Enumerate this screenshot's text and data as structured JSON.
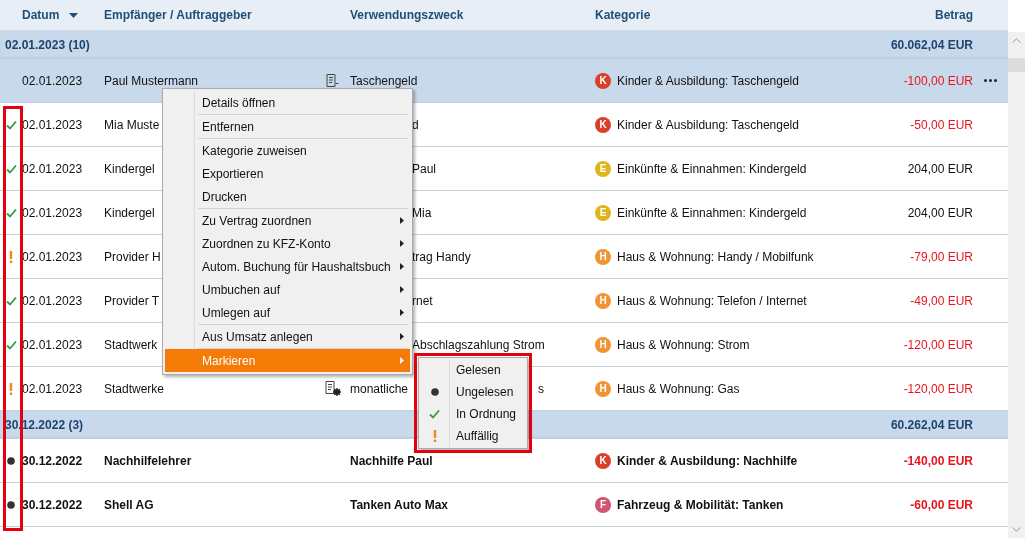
{
  "columns": [
    {
      "label": "Datum",
      "sorted": true
    },
    {
      "label": "Empfänger / Auftraggeber",
      "sorted": false
    },
    {
      "label": "Verwendungszweck",
      "sorted": false
    },
    {
      "label": "Kategorie",
      "sorted": false
    },
    {
      "label": "Betrag",
      "sorted": false
    }
  ],
  "groups": [
    {
      "label": "02.01.2023 (10)",
      "total": "60.062,04 EUR",
      "rows": [
        {
          "selected": true,
          "date": "02.01.2023",
          "payee": "Paul Mustermann",
          "note": {
            "kind": "plain"
          },
          "purpose": "Taschengeld",
          "cat_letter": "K",
          "color": "#d9402a",
          "category": "Kinder & Ausbildung: Taschengeld",
          "amount": "-100,00 EUR",
          "negative": true,
          "unread": false
        },
        {
          "selected": false,
          "date": "02.01.2023",
          "payee": "Mia Muste",
          "purpose_tail": "d",
          "cat_letter": "K",
          "color": "#d9402a",
          "category": "Kinder & Ausbildung: Taschengeld",
          "amount": "-50,00 EUR",
          "negative": true,
          "status": {
            "kind": "ok"
          },
          "unread": false
        },
        {
          "selected": false,
          "date": "02.01.2023",
          "payee": "Kindergel",
          "purpose_tail": "Paul",
          "cat_letter": "E",
          "color": "#e0b51b",
          "category": "Einkünfte & Einnahmen: Kindergeld",
          "amount": "204,00 EUR",
          "negative": false,
          "status": {
            "kind": "ok"
          },
          "unread": false
        },
        {
          "selected": false,
          "date": "02.01.2023",
          "payee": "Kindergel",
          "purpose_tail": "Mia",
          "cat_letter": "E",
          "color": "#e0b51b",
          "category": "Einkünfte & Einnahmen: Kindergeld",
          "amount": "204,00 EUR",
          "negative": false,
          "status": {
            "kind": "ok"
          },
          "unread": false
        },
        {
          "selected": false,
          "date": "02.01.2023",
          "payee": "Provider H",
          "purpose_tail": "trag Handy",
          "cat_letter": "H",
          "color": "#f39433",
          "category": "Haus & Wohnung: Handy / Mobilfunk",
          "amount": "-79,00 EUR",
          "negative": true,
          "status": {
            "kind": "flagged"
          },
          "unread": false
        },
        {
          "selected": false,
          "date": "02.01.2023",
          "payee": "Provider T",
          "purpose_tail": "rnet",
          "cat_letter": "H",
          "color": "#f39433",
          "category": "Haus & Wohnung: Telefon / Internet",
          "amount": "-49,00 EUR",
          "negative": true,
          "status": {
            "kind": "ok"
          },
          "unread": false
        },
        {
          "selected": false,
          "date": "02.01.2023",
          "payee": "Stadtwerk",
          "purpose_tail": "Abschlagszahlung Strom",
          "cat_letter": "H",
          "color": "#f39433",
          "category": "Haus & Wohnung: Strom",
          "amount": "-120,00 EUR",
          "negative": true,
          "status": {
            "kind": "ok"
          },
          "unread": false
        },
        {
          "selected": false,
          "date": "02.01.2023",
          "payee": "Stadtwerke",
          "note": {
            "kind": "gear"
          },
          "purpose": "monatliche",
          "purpose_tail": "s",
          "cat_letter": "H",
          "color": "#f39433",
          "category": "Haus & Wohnung: Gas",
          "amount": "-120,00 EUR",
          "negative": true,
          "status": {
            "kind": "flagged"
          },
          "unread": false
        }
      ]
    },
    {
      "label": "30.12.2022 (3)",
      "total": "60.262,04 EUR",
      "rows": [
        {
          "selected": false,
          "date": "30.12.2022",
          "payee": "Nachhilfelehrer",
          "purpose": "Nachhilfe Paul",
          "cat_letter": "K",
          "color": "#d9402a",
          "category": "Kinder & Ausbildung: Nachhilfe",
          "amount": "-140,00 EUR",
          "negative": true,
          "status": {
            "kind": "unread"
          },
          "unread": true
        },
        {
          "selected": false,
          "date": "30.12.2022",
          "payee": "Shell AG",
          "purpose": "Tanken Auto Max",
          "cat_letter": "F",
          "color": "#cf5571",
          "category": "Fahrzeug & Mobilität: Tanken",
          "amount": "-60,00 EUR",
          "negative": true,
          "status": {
            "kind": "unread"
          },
          "unread": true
        }
      ]
    }
  ],
  "context_menu": {
    "groups": [
      [
        {
          "label": "Details öffnen",
          "submenu": false,
          "selected": false
        }
      ],
      [
        {
          "label": "Entfernen",
          "submenu": false,
          "selected": false
        }
      ],
      [
        {
          "label": "Kategorie zuweisen",
          "submenu": false,
          "selected": false
        },
        {
          "label": "Exportieren",
          "submenu": false,
          "selected": false
        },
        {
          "label": "Drucken",
          "submenu": false,
          "selected": false
        }
      ],
      [
        {
          "label": "Zu Vertrag zuordnen",
          "submenu": true,
          "selected": false
        },
        {
          "label": "Zuordnen zu KFZ-Konto",
          "submenu": true,
          "selected": false
        },
        {
          "label": "Autom. Buchung für Haushaltsbuch",
          "submenu": true,
          "selected": false
        },
        {
          "label": "Umbuchen auf",
          "submenu": true,
          "selected": false
        },
        {
          "label": "Umlegen auf",
          "submenu": true,
          "selected": false
        }
      ],
      [
        {
          "label": "Aus Umsatz anlegen",
          "submenu": true,
          "selected": false
        }
      ],
      [
        {
          "label": "Markieren",
          "submenu": true,
          "selected": true
        }
      ]
    ]
  },
  "submenu": [
    {
      "label": "Gelesen",
      "kind": "none"
    },
    {
      "label": "Ungelesen",
      "kind": "unread"
    },
    {
      "label": "In Ordnung",
      "kind": "ok"
    },
    {
      "label": "Auffällig",
      "kind": "flagged"
    }
  ]
}
